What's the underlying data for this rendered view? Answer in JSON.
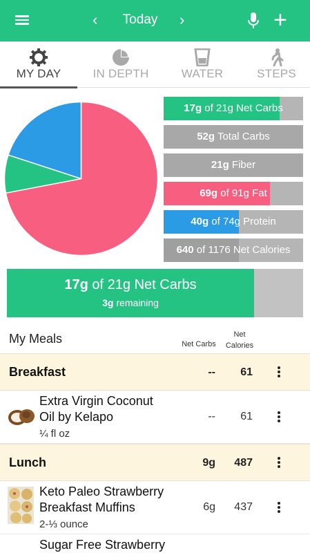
{
  "header": {
    "title": "Today",
    "prev_icon": "chevron-left-icon",
    "next_icon": "chevron-right-icon",
    "menu_icon": "hamburger-icon",
    "mic_icon": "microphone-icon",
    "add_icon": "plus-icon",
    "color": "#25c383"
  },
  "tabs": [
    {
      "label": "MY DAY",
      "icon": "gear-icon",
      "active": true
    },
    {
      "label": "IN DEPTH",
      "icon": "pie-chart-icon",
      "active": false
    },
    {
      "label": "WATER",
      "icon": "glass-icon",
      "active": false
    },
    {
      "label": "STEPS",
      "icon": "walking-icon",
      "active": false
    }
  ],
  "macro_pie": {
    "slices": [
      {
        "name": "Fat",
        "percent": 72,
        "color": "#f85e80"
      },
      {
        "name": "Carbs",
        "percent": 8,
        "color": "#25c383"
      },
      {
        "name": "Protein",
        "percent": 20,
        "color": "#2c9be6"
      }
    ]
  },
  "macro_bars": [
    {
      "value": "17g",
      "text": "of 21g Net Carbs",
      "fill_fraction": 0.83,
      "color": "#25c383"
    },
    {
      "value": "52g",
      "text": "Total Carbs",
      "fill_fraction": 0,
      "color": "#a8a8a8"
    },
    {
      "value": "21g",
      "text": "Fiber",
      "fill_fraction": 0,
      "color": "#a8a8a8"
    },
    {
      "value": "69g",
      "text": "of 91g Fat",
      "fill_fraction": 0.76,
      "color": "#f85e80"
    },
    {
      "value": "40g",
      "text": "of 74g Protein",
      "fill_fraction": 0.54,
      "color": "#2c9be6"
    },
    {
      "value": "640",
      "text": "of 1176 Net Calories",
      "fill_fraction": 0.54,
      "color": "#9f9f9f"
    }
  ],
  "summary": {
    "value": "17g",
    "text": "of 21g Net Carbs",
    "remaining_value": "3g",
    "remaining_text": "remaining",
    "fill_fraction": 0.834
  },
  "meals": {
    "title": "My Meals",
    "col_net_carbs": "Net Carbs",
    "col_net_calories_1": "Net",
    "col_net_calories_2": "Calories",
    "sections": [
      {
        "name": "Breakfast",
        "net_carbs": "--",
        "calories": "61"
      },
      {
        "name": "Lunch",
        "net_carbs": "9g",
        "calories": "487"
      }
    ],
    "items": [
      {
        "name_line1": "Extra Virgin Coconut",
        "name_line2": "Oil by Kelapo",
        "qty": "¼ fl oz",
        "net_carbs": "--",
        "calories": "61",
        "thumb": "coconut-icon"
      },
      {
        "name_line1": "Keto Paleo Strawberry",
        "name_line2": "Breakfast Muffins",
        "qty": "2-⅓ ounce",
        "net_carbs": "6g",
        "calories": "437",
        "thumb": "muffins-photo"
      },
      {
        "name_line1": "Sugar Free Strawberry"
      }
    ]
  }
}
